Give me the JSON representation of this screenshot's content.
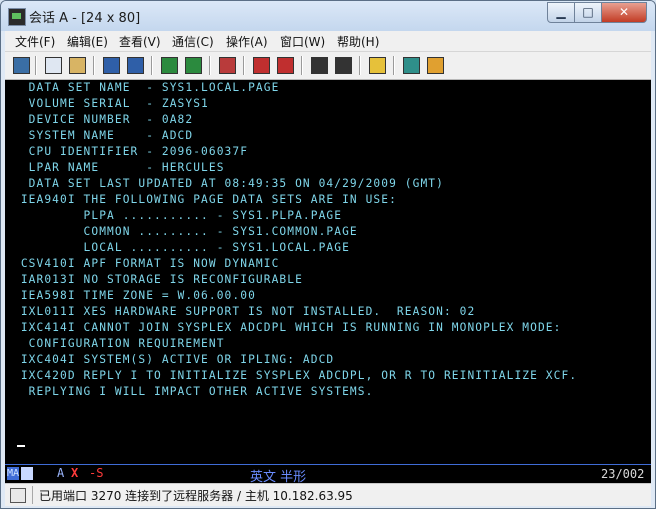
{
  "window": {
    "title": "会话 A - [24 x 80]"
  },
  "menu": [
    "文件(F)",
    "编辑(E)",
    "查看(V)",
    "通信(C)",
    "操作(A)",
    "窗口(W)",
    "帮助(H)"
  ],
  "toolbar": [
    {
      "name": "print-screen-icon",
      "color": "#3a6ea5"
    },
    {
      "name": "copy-icon",
      "color": "#dfe7f2"
    },
    {
      "name": "paste-icon",
      "color": "#d8b464"
    },
    {
      "name": "send-file-icon",
      "color": "#2f5fa8"
    },
    {
      "name": "receive-file-icon",
      "color": "#2f5fa8"
    },
    {
      "name": "display-setup-icon",
      "color": "#2b8a3e"
    },
    {
      "name": "keyboard-map-icon",
      "color": "#2b8a3e"
    },
    {
      "name": "chart-icon",
      "color": "#b93b3b"
    },
    {
      "name": "macro-play-icon",
      "color": "#c02f2f"
    },
    {
      "name": "macro-record-icon",
      "color": "#c02f2f"
    },
    {
      "name": "connect-icon",
      "color": "#333333"
    },
    {
      "name": "disconnect-icon",
      "color": "#333333"
    },
    {
      "name": "clipboard-icon",
      "color": "#e6c13a"
    },
    {
      "name": "palette-icon",
      "color": "#2f8f8a"
    },
    {
      "name": "settings-icon",
      "color": "#e0a030"
    }
  ],
  "terminal": {
    "lines": [
      "  DATA SET NAME  - SYS1.LOCAL.PAGE",
      "  VOLUME SERIAL  - ZASYS1",
      "  DEVICE NUMBER  - 0A82",
      "  SYSTEM NAME    - ADCD",
      "  CPU IDENTIFIER - 2096-06037F",
      "  LPAR NAME      - HERCULES",
      "  DATA SET LAST UPDATED AT 08:49:35 ON 04/29/2009 (GMT)",
      " IEA940I THE FOLLOWING PAGE DATA SETS ARE IN USE:",
      "         PLPA ........... - SYS1.PLPA.PAGE",
      "         COMMON ......... - SYS1.COMMON.PAGE",
      "         LOCAL .......... - SYS1.LOCAL.PAGE",
      " CSV410I APF FORMAT IS NOW DYNAMIC",
      " IAR013I NO STORAGE IS RECONFIGURABLE",
      " IEA598I TIME ZONE = W.06.00.00",
      " IXL011I XES HARDWARE SUPPORT IS NOT INSTALLED.  REASON: 02",
      " IXC414I CANNOT JOIN SYSPLEX ADCDPL WHICH IS RUNNING IN MONOPLEX MODE:",
      "  CONFIGURATION REQUIREMENT",
      " IXC404I SYSTEM(S) ACTIVE OR IPLING: ADCD",
      " IXC420D REPLY I TO INITIALIZE SYSPLEX ADCDPL, OR R TO REINITIALIZE XCF.",
      "  REPLYING I WILL IMPACT OTHER ACTIVE SYSTEMS."
    ]
  },
  "oia": {
    "ma": "MA",
    "lock": "A",
    "x": "X",
    "s": "-S",
    "ime": "英文 半形",
    "position": "23/002"
  },
  "status": {
    "text": "已用端口 3270 连接到了远程服务器 / 主机 10.182.63.95"
  }
}
